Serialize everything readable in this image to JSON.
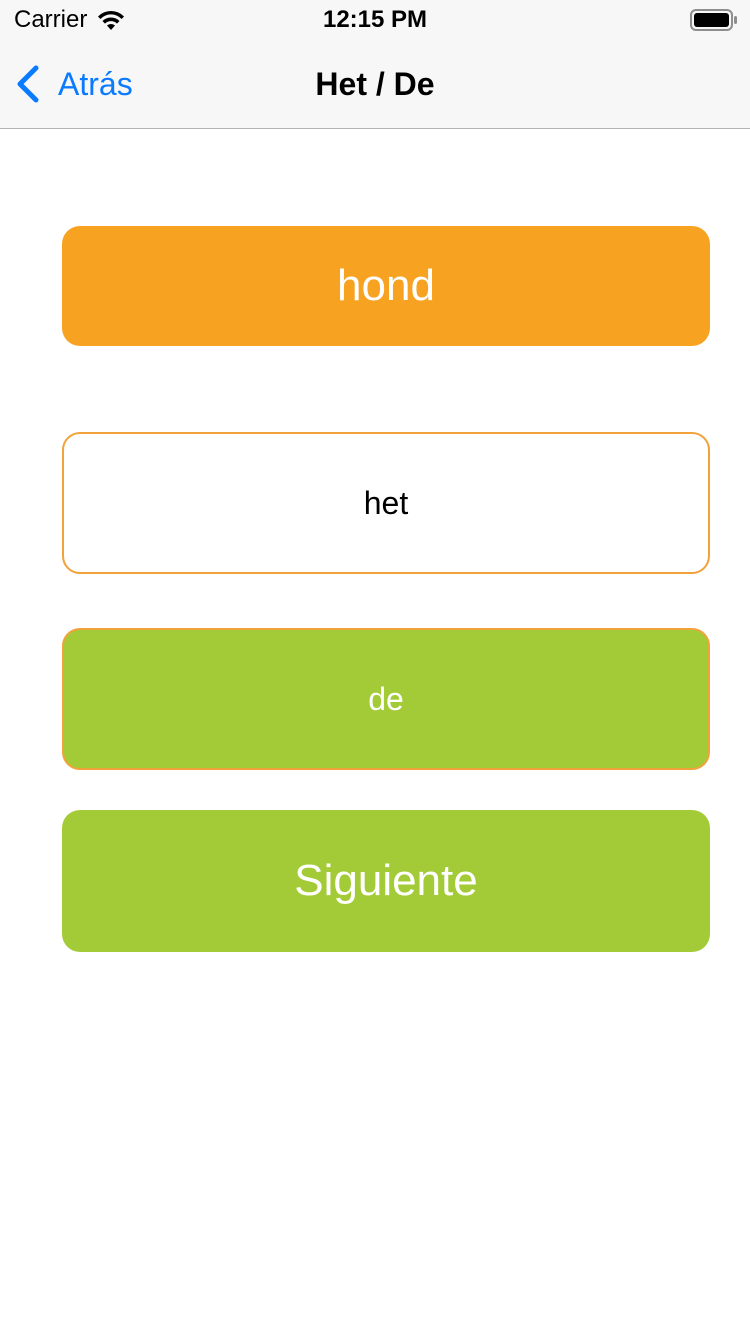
{
  "status_bar": {
    "carrier": "Carrier",
    "time": "12:15 PM",
    "icons": [
      "wifi-icon",
      "battery-icon"
    ]
  },
  "nav": {
    "back_label": "Atrás",
    "back_icon": "chevron-left-icon",
    "title": "Het / De"
  },
  "quiz": {
    "word": "hond",
    "options": [
      {
        "label": "het",
        "state": "unselected"
      },
      {
        "label": "de",
        "state": "correct"
      }
    ],
    "next_label": "Siguiente"
  },
  "colors": {
    "accent_blue": "#0a7aff",
    "word_card": "#f7a220",
    "correct_green": "#a3cb38",
    "option_border": "#f1a23a"
  }
}
